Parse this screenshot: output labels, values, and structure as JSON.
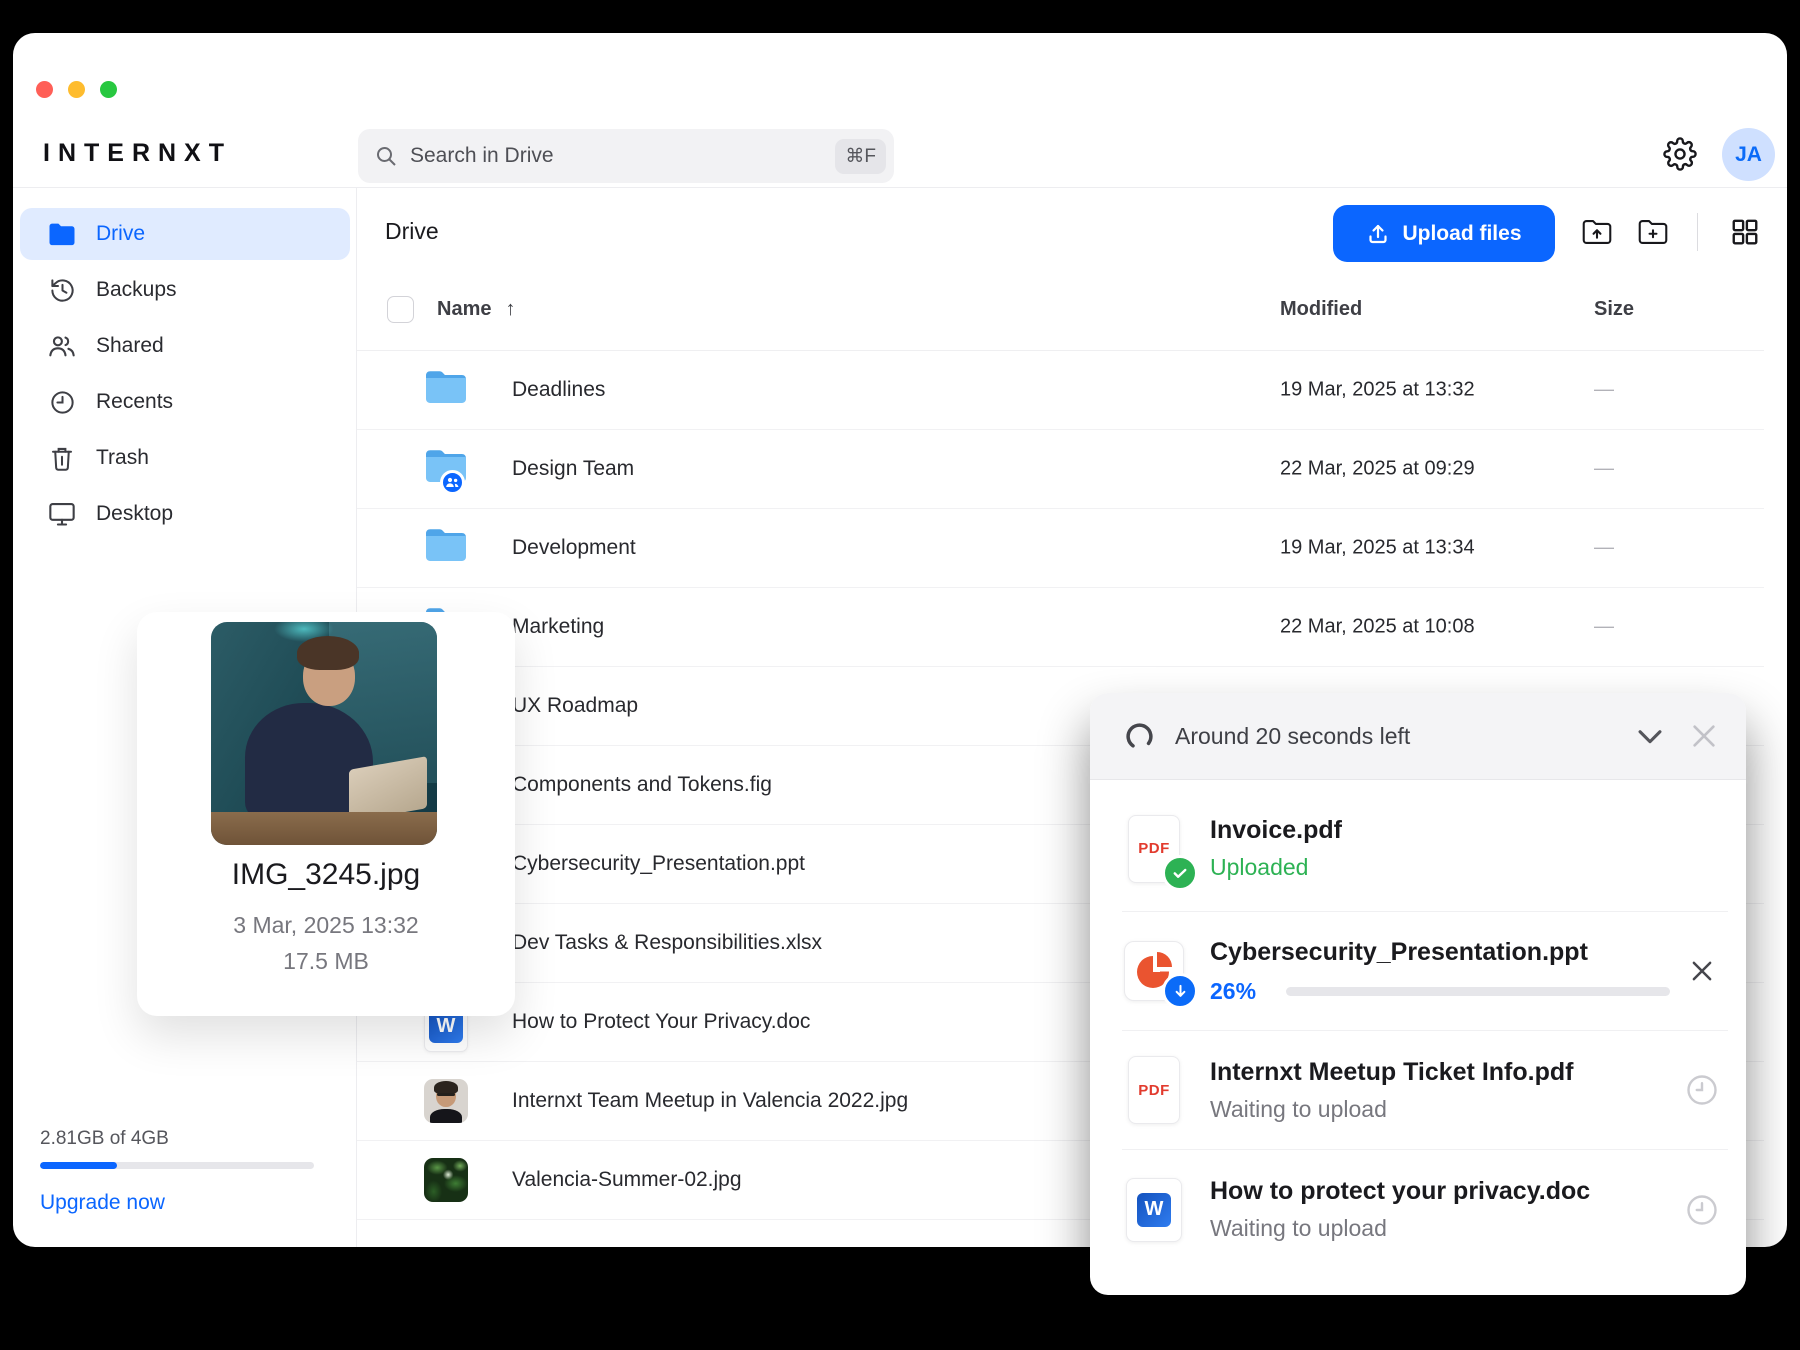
{
  "window": {
    "brand": "INTERNXT",
    "traffic_colors": {
      "close": "#FF5F57",
      "minimize": "#FEBC2E",
      "zoom": "#28C840"
    }
  },
  "search": {
    "placeholder": "Search in Drive",
    "shortcut": "⌘F"
  },
  "header": {
    "avatar_initials": "JA"
  },
  "sidebar": {
    "items": [
      {
        "label": "Drive",
        "active": true
      },
      {
        "label": "Backups",
        "active": false
      },
      {
        "label": "Shared",
        "active": false
      },
      {
        "label": "Recents",
        "active": false
      },
      {
        "label": "Trash",
        "active": false
      },
      {
        "label": "Desktop",
        "active": false
      }
    ],
    "storage": {
      "usage": "2.81GB of 4GB",
      "percent": 28,
      "upgrade_label": "Upgrade now"
    }
  },
  "toolbar": {
    "page_title": "Drive",
    "upload_label": "Upload files"
  },
  "table": {
    "headers": {
      "name": "Name",
      "sort_arrow": "↑",
      "modified": "Modified",
      "size": "Size"
    },
    "rows": [
      {
        "name": "Deadlines",
        "modified": "19 Mar, 2025 at 13:32",
        "size": "—"
      },
      {
        "name": "Design Team",
        "modified": "22 Mar, 2025 at 09:29",
        "size": "—"
      },
      {
        "name": "Development",
        "modified": "19 Mar, 2025 at 13:34",
        "size": "—"
      },
      {
        "name": "Marketing",
        "modified": "22 Mar, 2025 at 10:08",
        "size": "—"
      },
      {
        "name": "UX Roadmap"
      },
      {
        "name": "Components and Tokens.fig"
      },
      {
        "name": "Cybersecurity_Presentation.ppt"
      },
      {
        "name": "Dev Tasks & Responsibilities.xlsx"
      },
      {
        "name": "How to Protect Your Privacy.doc"
      },
      {
        "name": "Internxt Team Meetup in Valencia 2022.jpg"
      },
      {
        "name": "Valencia-Summer-02.jpg"
      }
    ]
  },
  "preview_card": {
    "filename": "IMG_3245.jpg",
    "date": "3 Mar, 2025 13:32",
    "size": "17.5 MB"
  },
  "upload_panel": {
    "title": "Around 20 seconds left",
    "items": [
      {
        "name": "Invoice.pdf",
        "status": "Uploaded",
        "icon": "pdf",
        "state": "done"
      },
      {
        "name": "Cybersecurity_Presentation.ppt",
        "percent_label": "26%",
        "progress": 26,
        "icon": "ppt",
        "state": "uploading"
      },
      {
        "name": "Internxt Meetup Ticket Info.pdf",
        "status": "Waiting to upload",
        "icon": "pdf",
        "state": "waiting"
      },
      {
        "name": "How to protect your privacy.doc",
        "status": "Waiting to upload",
        "icon": "word",
        "state": "waiting"
      }
    ]
  },
  "word_logo_letter": "W",
  "pdf_label": "PDF",
  "colors": {
    "accent": "#0B66FF",
    "success": "#2DB254",
    "pdf_red": "#E23B2E",
    "ppt_orange": "#EA5430"
  }
}
